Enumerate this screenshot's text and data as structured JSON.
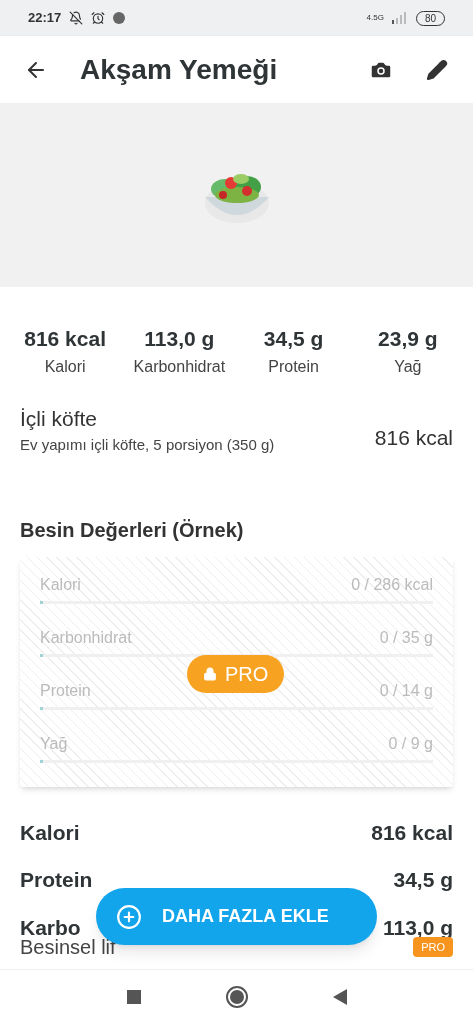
{
  "status_bar": {
    "time": "22:17",
    "battery": "80",
    "network": "4.5G"
  },
  "header": {
    "title": "Akşam Yemeği"
  },
  "summary": [
    {
      "value": "816 kcal",
      "label": "Kalori"
    },
    {
      "value": "113,0 g",
      "label": "Karbonhidrat"
    },
    {
      "value": "34,5 g",
      "label": "Protein"
    },
    {
      "value": "23,9 g",
      "label": "Yağ"
    }
  ],
  "food": {
    "name": "İçli köfte",
    "description": "Ev yapımı içli köfte, 5 porsiyon (350 g)",
    "calories": "816 kcal"
  },
  "nutrition_section": {
    "title": "Besin Değerleri (Örnek)",
    "badge": "PRO",
    "rows": [
      {
        "name": "Kalori",
        "reading": "0 / 286 kcal",
        "level": 0
      },
      {
        "name": "Karbonhidrat",
        "reading": "0 / 35 g",
        "level": 0
      },
      {
        "name": "Protein",
        "reading": "0 / 14 g",
        "level": 0
      },
      {
        "name": "Yağ",
        "reading": "0 / 9 g",
        "level": 0
      }
    ]
  },
  "totals": [
    {
      "kind": "main",
      "label": "Kalori",
      "value": "816 kcal"
    },
    {
      "kind": "main",
      "label": "Protein",
      "value": "34,5 g"
    },
    {
      "kind": "main",
      "label": "Karbo",
      "value": "113,0 g"
    },
    {
      "kind": "sub",
      "label": "Besinsel lif",
      "badge": "PRO"
    }
  ],
  "fab": {
    "label": "DAHA FAZLA EKLE"
  }
}
